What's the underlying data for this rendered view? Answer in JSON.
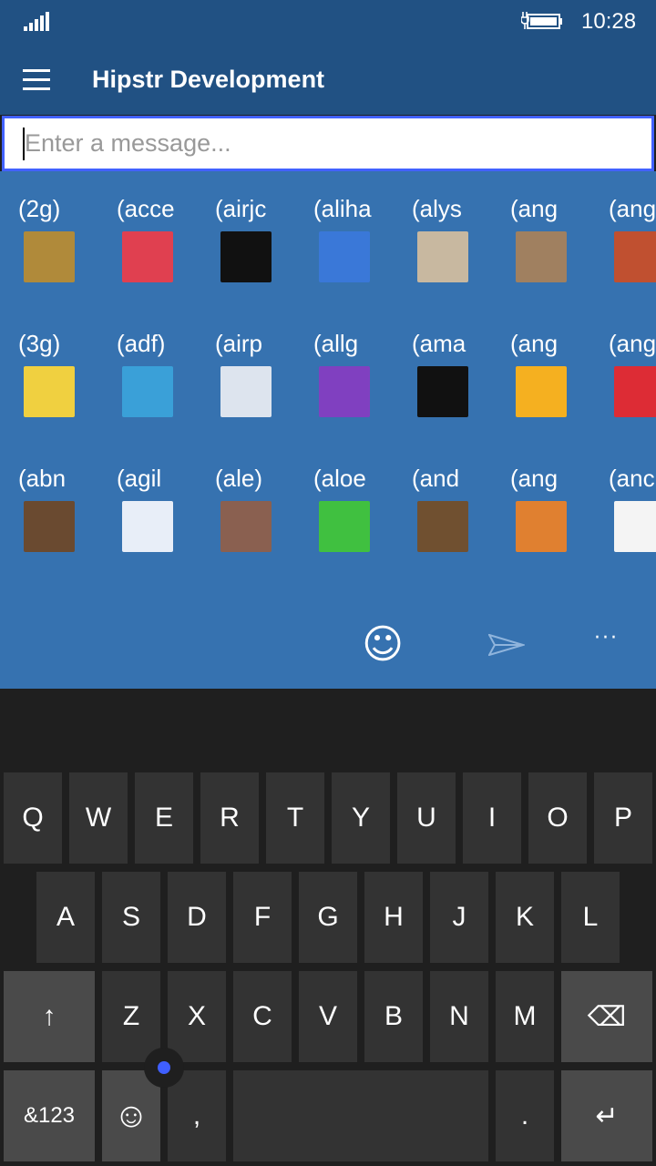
{
  "status": {
    "time": "10:28",
    "signal_icon": "signal-bars-icon",
    "battery_icon": "battery-charging-icon"
  },
  "header": {
    "title": "Hipstr Development",
    "menu_icon": "hamburger-icon"
  },
  "input": {
    "placeholder": "Enter a message...",
    "value": ""
  },
  "colors": {
    "header": "#215183",
    "panel": "#3672b0",
    "focus": "#4262ff",
    "keyboard": "#1f1f1f"
  },
  "emoticons": [
    {
      "label": "(2g)",
      "color": "#b08a3a"
    },
    {
      "label": "(acce",
      "color": "#e04050"
    },
    {
      "label": "(airjc",
      "color": "#111111"
    },
    {
      "label": "(aliha",
      "color": "#3a78d8"
    },
    {
      "label": "(alys",
      "color": "#c8b8a0"
    },
    {
      "label": "(ang",
      "color": "#a08060"
    },
    {
      "label": "(ang",
      "color": "#c05030"
    },
    {
      "label": "(3g)",
      "color": "#f0d040"
    },
    {
      "label": "(adf)",
      "color": "#3aa0d8"
    },
    {
      "label": "(airp",
      "color": "#dde4ee"
    },
    {
      "label": "(allg",
      "color": "#8040c0"
    },
    {
      "label": "(ama",
      "color": "#111111"
    },
    {
      "label": "(ang",
      "color": "#f5b020"
    },
    {
      "label": "(ang",
      "color": "#dd2c35"
    },
    {
      "label": "(abn",
      "color": "#6a4a30"
    },
    {
      "label": "(agil",
      "color": "#e8eef8"
    },
    {
      "label": "(ale)",
      "color": "#8a6050"
    },
    {
      "label": "(aloe",
      "color": "#40c040"
    },
    {
      "label": "(and",
      "color": "#705030"
    },
    {
      "label": "(ang",
      "color": "#e08030"
    },
    {
      "label": "(anc",
      "color": "#f4f4f4"
    }
  ],
  "appbar": {
    "emoji_glyph": "☺",
    "send_icon": "send-icon",
    "more_glyph": "···"
  },
  "keyboard": {
    "row1": [
      "Q",
      "W",
      "E",
      "R",
      "T",
      "Y",
      "U",
      "I",
      "O",
      "P"
    ],
    "row2": [
      "A",
      "S",
      "D",
      "F",
      "G",
      "H",
      "J",
      "K",
      "L"
    ],
    "row3": [
      "Z",
      "X",
      "C",
      "V",
      "B",
      "N",
      "M"
    ],
    "shift": "↑",
    "backspace": "⌫",
    "numbers": "&123",
    "emoji": "☺",
    "comma": ",",
    "period": ".",
    "enter": "↵"
  }
}
